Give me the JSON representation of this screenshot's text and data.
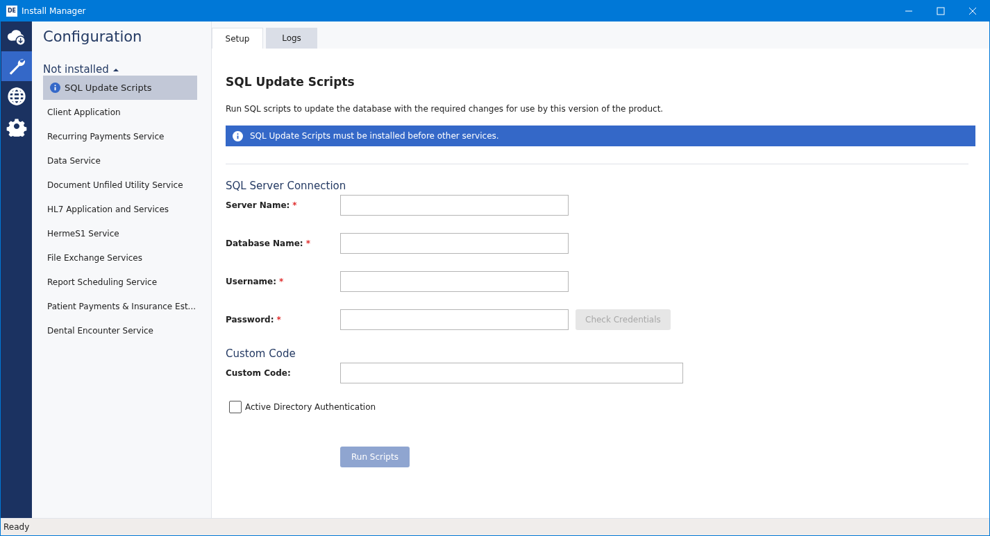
{
  "window": {
    "logo_text": "DE",
    "title": "Install Manager"
  },
  "rail": [
    {
      "kind": "cloud",
      "selected": false
    },
    {
      "kind": "wrench",
      "selected": true
    },
    {
      "kind": "globe",
      "selected": false
    },
    {
      "kind": "gear",
      "selected": false
    }
  ],
  "sidebar": {
    "title": "Configuration",
    "group": {
      "label": "Not installed",
      "expanded": true,
      "items": [
        {
          "label": "SQL Update Scripts",
          "selected": true,
          "info": true
        },
        {
          "label": "Client Application",
          "selected": false,
          "info": false
        },
        {
          "label": "Recurring Payments Service",
          "selected": false,
          "info": false
        },
        {
          "label": "Data Service",
          "selected": false,
          "info": false
        },
        {
          "label": "Document Unfiled Utility Service",
          "selected": false,
          "info": false
        },
        {
          "label": "HL7 Application and Services",
          "selected": false,
          "info": false
        },
        {
          "label": "HermeS1 Service",
          "selected": false,
          "info": false
        },
        {
          "label": "File Exchange Services",
          "selected": false,
          "info": false
        },
        {
          "label": "Report Scheduling Service",
          "selected": false,
          "info": false
        },
        {
          "label": "Patient Payments & Insurance Est...",
          "selected": false,
          "info": false
        },
        {
          "label": "Dental Encounter Service",
          "selected": false,
          "info": false
        }
      ]
    }
  },
  "tabs": [
    {
      "label": "Setup",
      "selected": true
    },
    {
      "label": "Logs",
      "selected": false
    }
  ],
  "page": {
    "title": "SQL Update Scripts",
    "description": "Run SQL scripts to update the database with the required changes for use by this version of the product.",
    "banner": "SQL Update Scripts must be installed before other services."
  },
  "sections": [
    {
      "title": "SQL Server Connection",
      "fields": [
        {
          "label": "Server Name:",
          "required_mark": "*",
          "wide": false
        },
        {
          "label": "Database Name:",
          "required_mark": "*",
          "wide": false
        },
        {
          "label": "Username:",
          "required_mark": "*",
          "wide": false
        },
        {
          "label": "Password:",
          "required_mark": "*",
          "wide": false,
          "button": {
            "label": "Check Credentials",
            "disabled": true
          }
        }
      ]
    },
    {
      "title": "Custom Code",
      "fields": [
        {
          "label": "Custom Code:",
          "wide": true
        }
      ]
    }
  ],
  "checkbox": {
    "label": "Active Directory Authentication",
    "checked": false
  },
  "run_button": {
    "label": "Run Scripts",
    "disabled": true
  },
  "status_bar": "Ready"
}
